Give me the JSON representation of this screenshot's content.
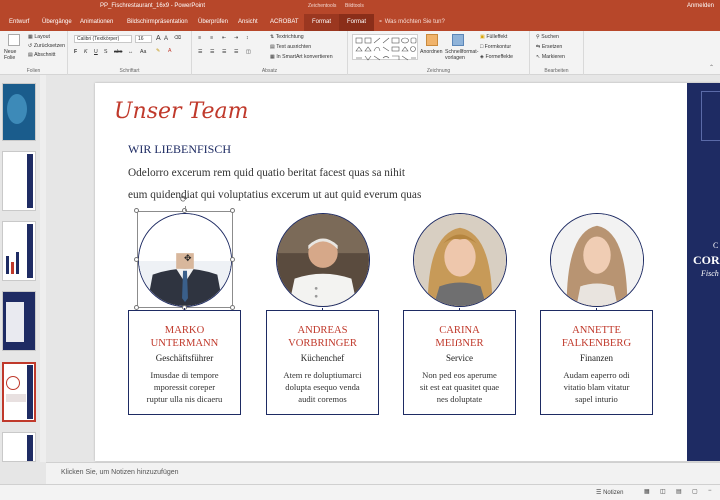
{
  "window": {
    "title": "PP_Fischrestaurant_16x9 - PowerPoint",
    "context_label_1": "Zeichentools",
    "context_label_2": "Bildtools",
    "signin": "Anmelden"
  },
  "tabs": [
    "Entwurf",
    "Übergänge",
    "Animationen",
    "Bildschirmpräsentation",
    "Überprüfen",
    "Ansicht",
    "ACROBAT",
    "Format",
    "Format"
  ],
  "tell_me": "Was möchten Sie tun?",
  "ribbon": {
    "folien": {
      "new_slide": "Neue Folie",
      "layout": "Layout",
      "reset": "Zurücksetzen",
      "section": "Abschnitt",
      "label": "Folien"
    },
    "schrift": {
      "font": "Calibri (Textkörper)",
      "size": "16",
      "label": "Schriftart"
    },
    "absatz": {
      "text_direction": "Textrichtung",
      "align_text": "Text ausrichten",
      "smartart": "In SmartArt konvertieren",
      "label": "Absatz"
    },
    "zeichnung": {
      "arrange": "Anordnen",
      "quick_styles": "Schnellformat-vorlagen",
      "fill": "Fülleffekt",
      "outline": "Formkontur",
      "effects": "Formeffekte",
      "label": "Zeichnung"
    },
    "bearbeiten": {
      "find": "Suchen",
      "replace": "Ersetzen",
      "select": "Markieren",
      "label": "Bearbeiten"
    }
  },
  "slide": {
    "title": "Unser Team",
    "subtitle": "WIR LIEBENFISCH",
    "body_line1": "Odelorro excerum rem quid quatio beritat facest quas sa nihit",
    "body_line2": "eum quidendiat qui voluptatius excerum ut aut quid everum quas",
    "brand_initials": "C",
    "brand_line1": "CORO",
    "brand_line2": "Fisch",
    "team": [
      {
        "name_line1": "MARKO",
        "name_line2": "UNTERMANN",
        "role": "Geschäftsführer",
        "desc_line1": "Imusdae di tempore",
        "desc_line2": "mporessit coreper",
        "desc_line3": "ruptur ulla nis dicaeru"
      },
      {
        "name_line1": "ANDREAS",
        "name_line2": "VORBRINGER",
        "role": "Küchenchef",
        "desc_line1": "Atem re doluptiumarci",
        "desc_line2": "dolupta esequo venda",
        "desc_line3": "audit coremos"
      },
      {
        "name_line1": "CARINA",
        "name_line2": "MEIẞNER",
        "role": "Service",
        "desc_line1": "Non ped eos aperume",
        "desc_line2": "sit est eat quasitet quae",
        "desc_line3": "nes doluptate"
      },
      {
        "name_line1": "ANNETTE",
        "name_line2": "FALKENBERG",
        "role": "Finanzen",
        "desc_line1": "Audam eaperro odi",
        "desc_line2": "vitatio blam vitatur",
        "desc_line3": "sapel inturio"
      }
    ]
  },
  "notes_placeholder": "Klicken Sie, um Notizen hinzuzufügen",
  "status": {
    "notes": "Notizen"
  }
}
